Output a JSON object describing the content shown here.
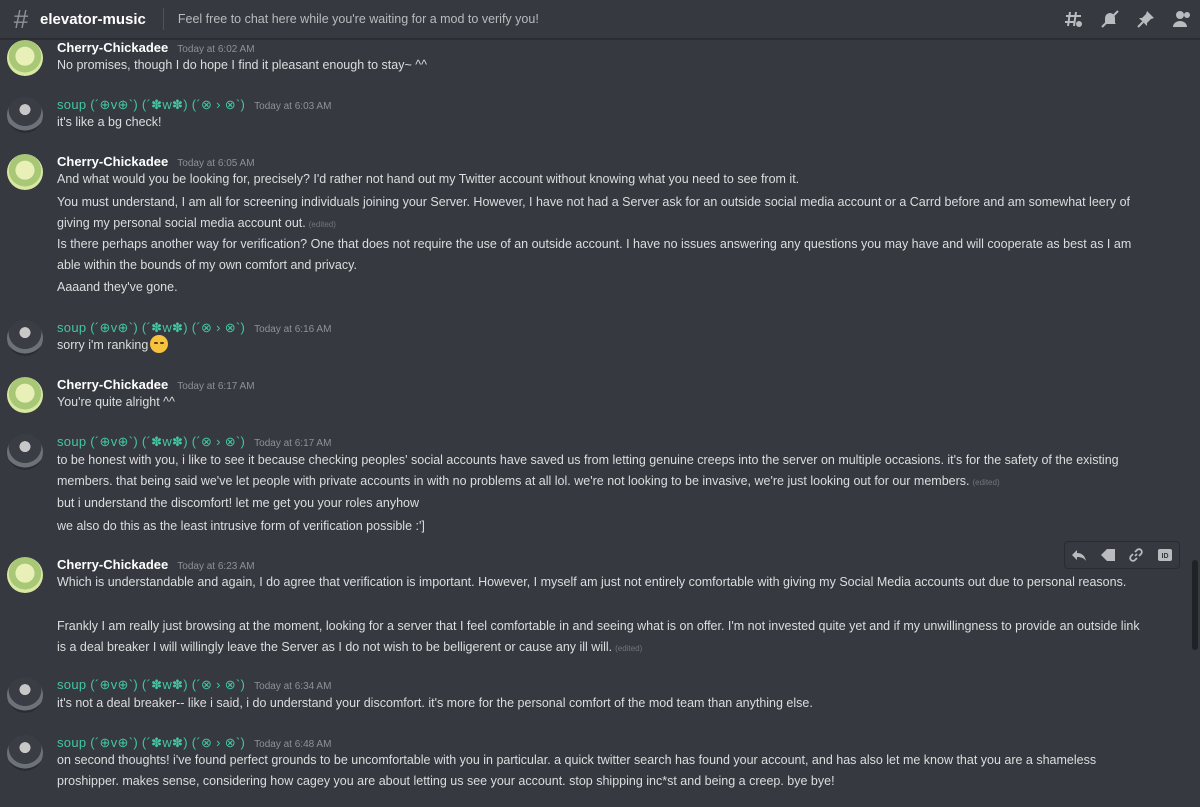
{
  "header": {
    "channel": "elevator-music",
    "topic": "Feel free to chat here while you're waiting for a mod to verify you!",
    "icons": [
      "threads-icon",
      "mute-bell-icon",
      "pin-icon",
      "members-icon"
    ]
  },
  "messages": [
    {
      "author": "Cherry-Chickadee",
      "time": "Today at 6:02 AM",
      "lines": [
        "No promises, though I do hope I find it pleasant enough to stay~ ^^"
      ]
    },
    {
      "author": "soup (´⊕v⊕`) (´✽w✽) (´⊗ › ⊗`)",
      "time": "Today at 6:03 AM",
      "lines": [
        "it's like a bg check!"
      ]
    },
    {
      "author": "Cherry-Chickadee",
      "time": "Today at 6:05 AM",
      "lines": [
        "And what would you be looking for, precisely? I'd rather not hand out my Twitter account without knowing what you need to see from it.",
        "You must understand, I am all for screening individuals joining your Server. However, I have not had a Server ask for an outside social media account or a Carrd before and am somewhat leery of giving my personal social media account out.",
        "Is there perhaps another way for verification? One that does not require the use of an outside account. I have no issues answering any questions you may have and will cooperate as best as I am able within the bounds of my own comfort and privacy.",
        "Aaaand they've gone."
      ]
    },
    {
      "author": "soup (´⊕v⊕`) (´✽w✽) (´⊗ › ⊗`)",
      "time": "Today at 6:16 AM",
      "lines": [
        "sorry i'm ranking"
      ]
    },
    {
      "author": "Cherry-Chickadee",
      "time": "Today at 6:17 AM",
      "lines": [
        "You're quite alright ^^"
      ]
    },
    {
      "author": "soup (´⊕v⊕`) (´✽w✽) (´⊗ › ⊗`)",
      "time": "Today at 6:17 AM",
      "lines": [
        "to be honest with you, i like to see it because checking peoples' social accounts have saved us from letting genuine creeps into the server on multiple occasions. it's for the safety of the existing members. that being said we've let people with private accounts in with no problems at all lol. we're not looking to be invasive, we're just looking out for our members.",
        "but i understand the discomfort! let me get you your roles anyhow",
        "we also do this as the least intrusive form of verification possible :']"
      ]
    },
    {
      "author": "Cherry-Chickadee",
      "time": "Today at 6:23 AM",
      "lines": [
        "Which is understandable and again, I do agree that verification is important. However, I myself am just not entirely comfortable with giving my Social Media accounts out due to personal reasons.",
        "Frankly I am really just browsing at the moment, looking for a server that I feel comfortable in and seeing what is on offer. I'm not invested quite yet and if my unwillingness to provide an outside link is a deal breaker I will willingly leave the Server as I do not wish to be belligerent or cause any ill will."
      ]
    },
    {
      "author": "soup (´⊕v⊕`) (´✽w✽) (´⊗ › ⊗`)",
      "time": "Today at 6:34 AM",
      "lines": [
        "it's not a deal breaker-- like i said, i do understand your discomfort. it's more for the personal comfort of the mod team than anything else."
      ]
    },
    {
      "author": "soup (´⊕v⊕`) (´✽w✽) (´⊗ › ⊗`)",
      "time": "Today at 6:48 AM",
      "lines": [
        "on second thoughts! i've found perfect grounds to be uncomfortable with you in particular. a quick twitter search has found your account, and has also let me know that you are a shameless proshipper. makes sense, considering how cagey you are about letting us see your account. stop shipping inc*st and being a creep. bye bye!"
      ]
    }
  ],
  "edited_label": "(edited)",
  "hover_toolbar": [
    "reply-icon",
    "tag-icon",
    "link-icon",
    "id-icon"
  ]
}
